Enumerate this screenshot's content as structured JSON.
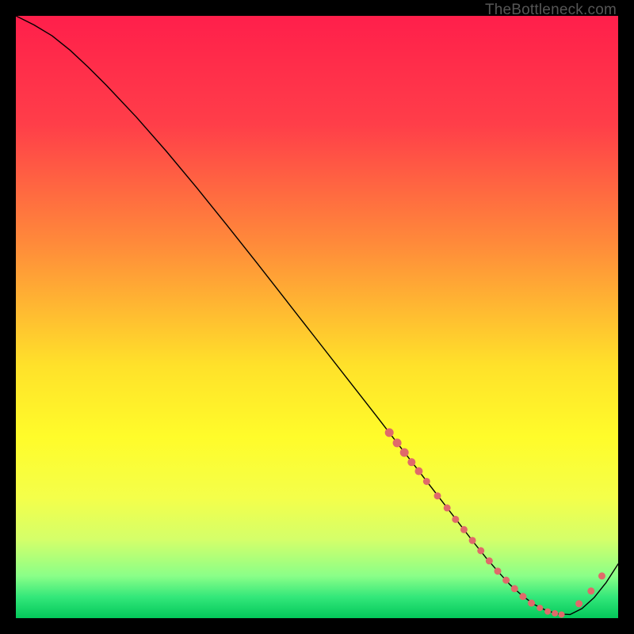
{
  "watermark": "TheBottleneck.com",
  "chart_data": {
    "type": "line",
    "title": "",
    "xlabel": "",
    "ylabel": "",
    "xlim": [
      0,
      100
    ],
    "ylim": [
      0,
      100
    ],
    "gradient_stops": [
      {
        "offset": 0.0,
        "color": "#ff1f4b"
      },
      {
        "offset": 0.18,
        "color": "#ff3e49"
      },
      {
        "offset": 0.38,
        "color": "#ff8b3a"
      },
      {
        "offset": 0.58,
        "color": "#ffe12a"
      },
      {
        "offset": 0.7,
        "color": "#fffc2a"
      },
      {
        "offset": 0.8,
        "color": "#f4ff4a"
      },
      {
        "offset": 0.87,
        "color": "#d4ff6a"
      },
      {
        "offset": 0.93,
        "color": "#8aff88"
      },
      {
        "offset": 0.965,
        "color": "#33e77a"
      },
      {
        "offset": 1.0,
        "color": "#03c85a"
      }
    ],
    "series": [
      {
        "name": "bottleneck-curve",
        "color": "#000000",
        "width": 1.4,
        "x": [
          0,
          3,
          6,
          9,
          12,
          15,
          20,
          25,
          30,
          35,
          40,
          45,
          50,
          55,
          60,
          63,
          66,
          69,
          72,
          74,
          76,
          78,
          80,
          82,
          84,
          86,
          88,
          90,
          92,
          94,
          96,
          98,
          100
        ],
        "y": [
          100,
          98.5,
          96.7,
          94.3,
          91.5,
          88.5,
          83.2,
          77.5,
          71.5,
          65.3,
          59.0,
          52.6,
          46.2,
          39.8,
          33.4,
          29.5,
          25.6,
          21.7,
          17.8,
          15.2,
          12.6,
          10.1,
          7.8,
          5.6,
          3.8,
          2.3,
          1.3,
          0.7,
          0.6,
          1.6,
          3.4,
          5.9,
          9.0
        ]
      }
    ],
    "markers": {
      "name": "curve-markers",
      "color": "#e06a6a",
      "radius_seq": [
        5.5,
        5.5,
        5.5,
        5.0,
        5.0,
        4.5,
        4.5,
        4.5,
        4.5,
        4.5,
        4.5,
        4.5,
        4.5,
        4.5,
        4.5,
        4.5,
        4.5,
        4.5,
        4.0,
        4.0,
        4.0,
        4.0,
        4.5,
        4.5,
        4.5
      ],
      "x": [
        62.0,
        63.3,
        64.5,
        65.7,
        66.9,
        68.2,
        70.0,
        71.6,
        73.0,
        74.4,
        75.8,
        77.2,
        78.6,
        80.0,
        81.4,
        82.8,
        84.2,
        85.6,
        87.0,
        88.3,
        89.5,
        90.6,
        93.5,
        95.5,
        97.3
      ],
      "y": [
        30.8,
        29.1,
        27.5,
        25.9,
        24.4,
        22.7,
        20.3,
        18.3,
        16.4,
        14.7,
        12.9,
        11.2,
        9.5,
        7.8,
        6.3,
        4.9,
        3.6,
        2.5,
        1.7,
        1.1,
        0.8,
        0.6,
        2.4,
        4.5,
        7.0
      ]
    }
  }
}
